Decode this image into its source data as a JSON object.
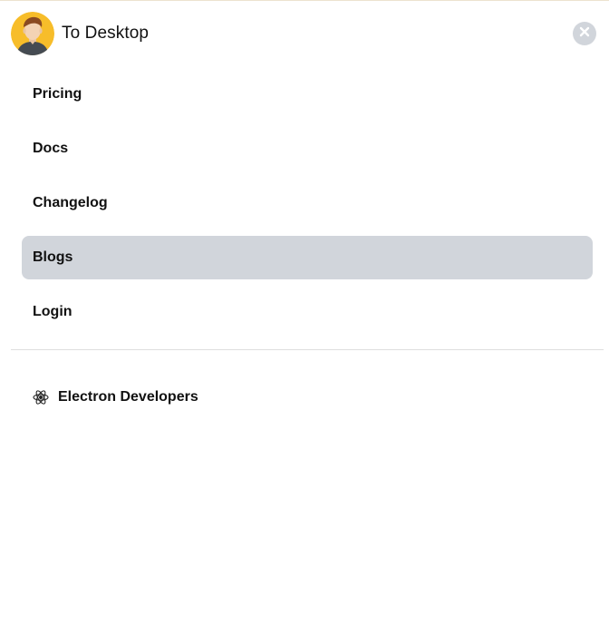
{
  "header": {
    "title": "To Desktop",
    "avatar_icon": "user-avatar",
    "close_icon": "close-icon"
  },
  "nav": {
    "items": [
      {
        "label": "Pricing",
        "active": false
      },
      {
        "label": "Docs",
        "active": false
      },
      {
        "label": "Changelog",
        "active": false
      },
      {
        "label": "Blogs",
        "active": true
      },
      {
        "label": "Login",
        "active": false
      }
    ]
  },
  "footer": {
    "link_label": "Electron Developers",
    "link_icon": "electron-icon"
  },
  "colors": {
    "active_bg": "#d1d5db",
    "avatar_bg": "#f7bd2a",
    "close_bg": "#d1d5db"
  }
}
